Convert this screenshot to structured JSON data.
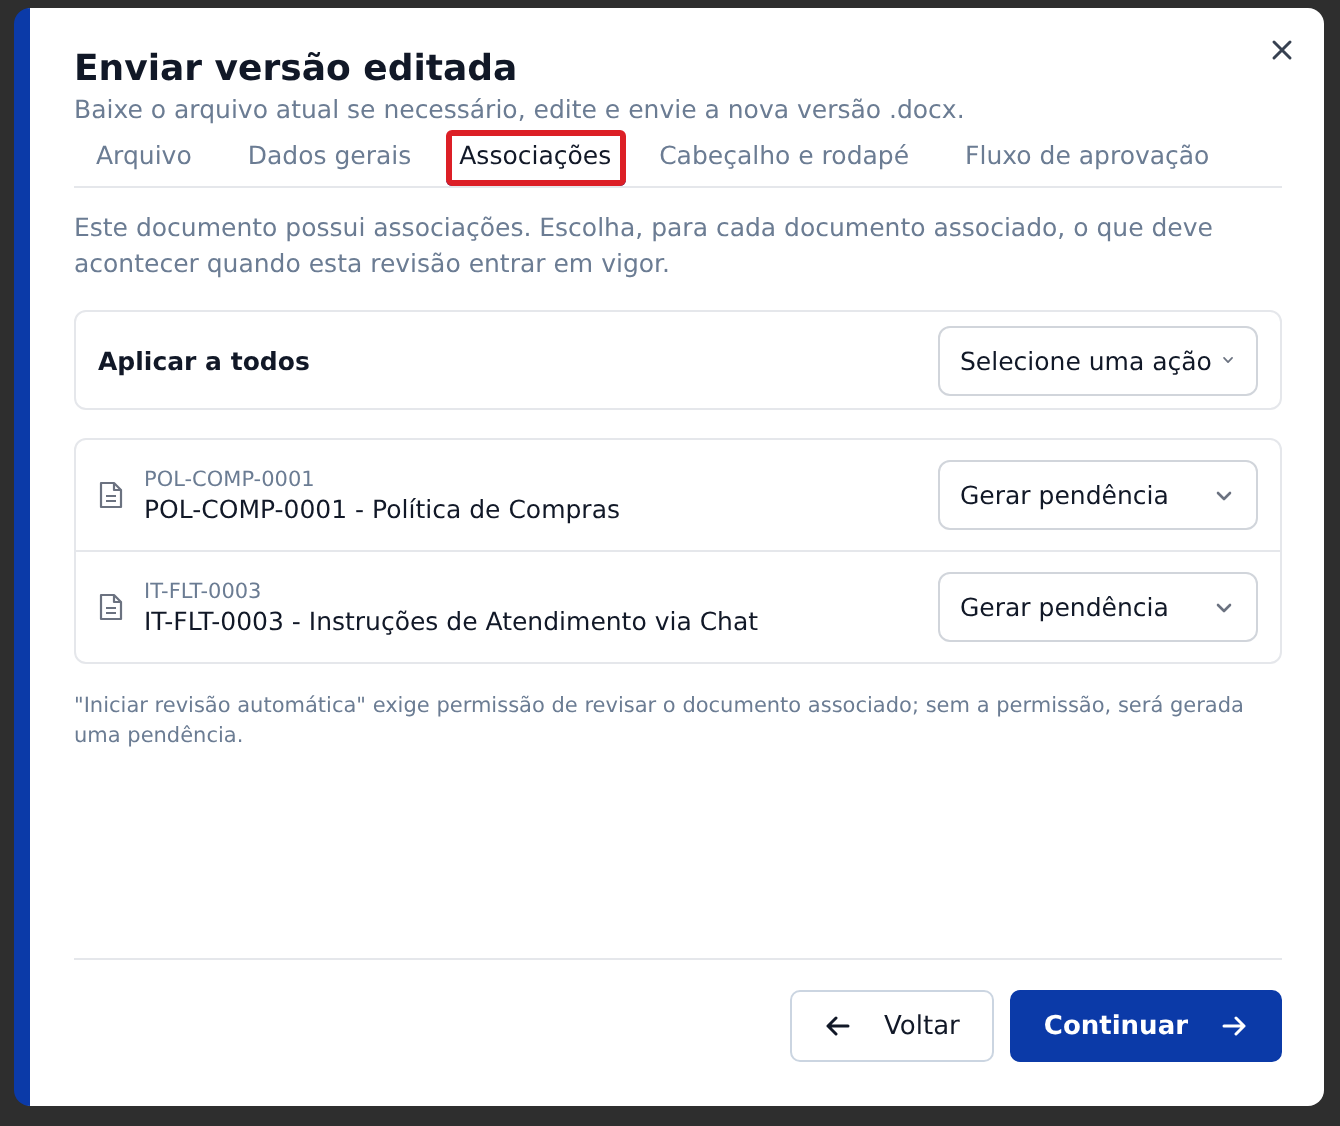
{
  "dialog": {
    "title": "Enviar versão editada",
    "subtitle": "Baixe o arquivo atual se necessário, edite e envie a nova versão .docx."
  },
  "tabs": [
    {
      "label": "Arquivo",
      "selected": false
    },
    {
      "label": "Dados gerais",
      "selected": false
    },
    {
      "label": "Associações",
      "selected": true
    },
    {
      "label": "Cabeçalho e rodapé",
      "selected": false
    },
    {
      "label": "Fluxo de aprovação",
      "selected": false
    }
  ],
  "description": "Este documento possui associações. Escolha, para cada documento associado, o que deve acontecer quando esta revisão entrar em vigor.",
  "apply_all": {
    "label": "Aplicar a todos",
    "placeholder": "Selecione uma ação"
  },
  "documents": [
    {
      "code": "POL-COMP-0001",
      "title": "POL-COMP-0001 - Política de Compras",
      "action": "Gerar pendência"
    },
    {
      "code": "IT-FLT-0003",
      "title": "IT-FLT-0003 - Instruções de Atendimento via Chat",
      "action": "Gerar pendência"
    }
  ],
  "note": "\"Iniciar revisão automática\" exige permissão de revisar o documento associado; sem a permissão, será gerada uma pendência.",
  "buttons": [
    {
      "label": "Voltar",
      "kind": "back"
    },
    {
      "label": "Continuar",
      "kind": "next"
    }
  ]
}
